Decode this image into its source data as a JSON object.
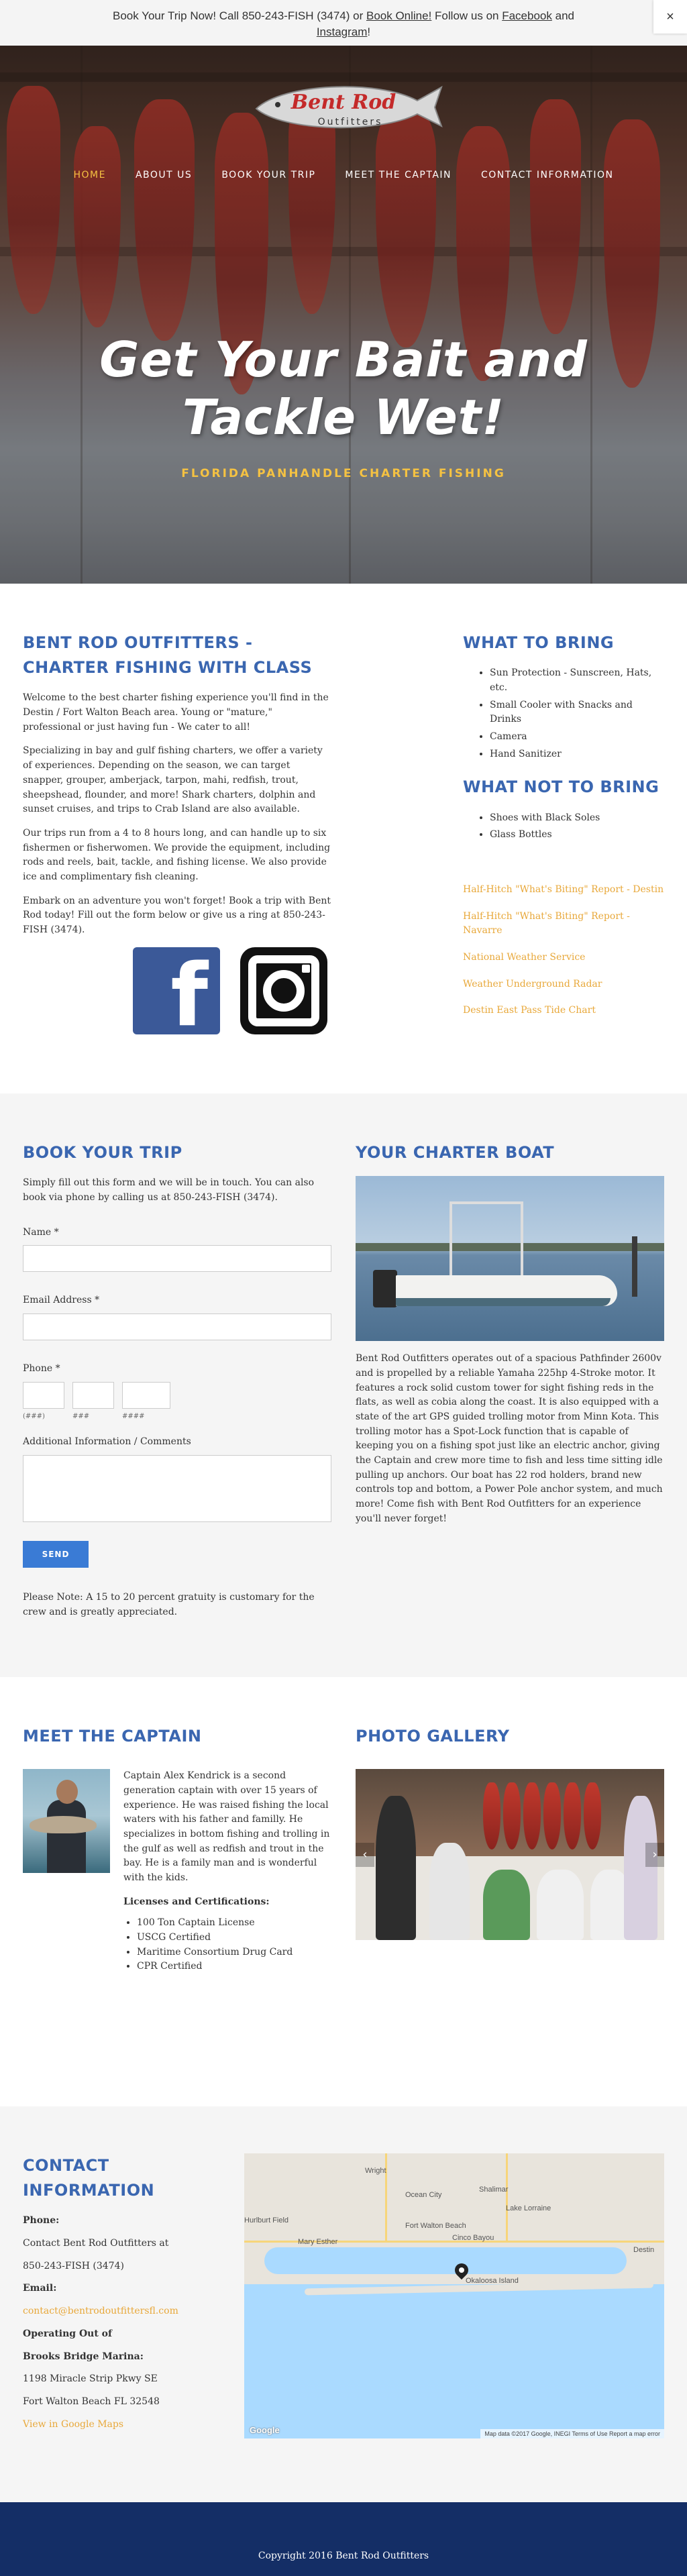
{
  "topbar": {
    "text_before": "Book Your Trip Now! Call 850-243-FISH (3474) or ",
    "book_online_link": "Book Online!",
    "text_middle": " Follow us on ",
    "facebook_link": "Facebook",
    "text_and": " and ",
    "instagram_link": "Instagram",
    "text_end": "!",
    "close_label": "×"
  },
  "logo": {
    "brand_main": "Bent Rod",
    "brand_sub": "Outfitters"
  },
  "nav": {
    "items": [
      "HOME",
      "ABOUT US",
      "BOOK YOUR TRIP",
      "MEET THE CAPTAIN",
      "CONTACT INFORMATION"
    ],
    "active_index": 0
  },
  "hero": {
    "headline_line1": "Get Your Bait and",
    "headline_line2": "Tackle Wet!",
    "subheadline": "FLORIDA PANHANDLE CHARTER FISHING"
  },
  "about": {
    "title": "BENT ROD OUTFITTERS - CHARTER FISHING WITH CLASS",
    "paragraphs": [
      "Welcome to the best charter fishing experience you'll find in the Destin / Fort Walton Beach area. Young or \"mature,\" professional or just having fun - We cater to all!",
      "Specializing in bay and gulf fishing charters, we offer a variety of experiences. Depending on the season, we can target snapper, grouper, amberjack, tarpon, mahi, redfish, trout, sheepshead, flounder, and more! Shark charters, dolphin and sunset cruises, and trips to Crab Island are also available.",
      "Our trips run from a 4 to 8 hours long, and can handle up to six fishermen or fisherwomen. We provide the equipment, including rods and reels, bait, tackle, and fishing license. We also provide ice and complimentary fish cleaning.",
      "Embark on an adventure you won't forget! Book a trip with Bent Rod today! Fill out the form below or give us a ring at 850-243-FISH (3474)."
    ],
    "facebook_glyph": "f"
  },
  "what_to_bring": {
    "title": "WHAT TO BRING",
    "items": [
      "Sun Protection - Sunscreen, Hats, etc.",
      "Small Cooler with Snacks and Drinks",
      "Camera",
      "Hand Sanitizer"
    ]
  },
  "what_not_to_bring": {
    "title": "WHAT NOT TO BRING",
    "items": [
      "Shoes with Black Soles",
      "Glass Bottles"
    ]
  },
  "links": [
    "Half-Hitch \"What's Biting\" Report - Destin",
    "Half-Hitch \"What's Biting\" Report - Navarre",
    "National Weather Service",
    "Weather Underground Radar",
    "Destin East Pass Tide Chart"
  ],
  "booking": {
    "title": "BOOK YOUR TRIP",
    "intro": "Simply fill out this form and we will be in touch. You can also book via phone by calling us at 850-243-FISH (3474).",
    "name_label": "Name *",
    "email_label": "Email Address *",
    "phone_label": "Phone *",
    "phone_hint_1": "(###)",
    "phone_hint_2": "###",
    "phone_hint_3": "####",
    "additional_label": "Additional Information / Comments",
    "send_label": "SEND",
    "note": "Please Note: A 15 to 20 percent gratuity is customary for the crew and is greatly appreciated."
  },
  "charter_boat": {
    "title": "YOUR CHARTER BOAT",
    "description": "Bent Rod Outfitters operates out of a spacious Pathfinder 2600v and is propelled by a reliable Yamaha 225hp 4-Stroke motor. It features a rock solid custom tower for sight fishing reds in the flats, as well as cobia along the coast. It is also equipped with a state of the art GPS guided trolling motor from Minn Kota. This trolling motor has a Spot-Lock function that is capable of keeping you on a fishing spot just like an electric anchor, giving the Captain and crew more time to fish and less time sitting idle pulling up anchors. Our boat has 22 rod holders, brand new controls top and bottom, a Power Pole anchor system, and much more! Come fish with Bent Rod Outfitters for an experience you'll never forget!"
  },
  "captain": {
    "title": "MEET THE CAPTAIN",
    "bio": "Captain Alex Kendrick is a second generation captain with over 15 years of experience. He was raised fishing the local waters with his father and familly. He specializes in bottom fishing and trolling in the gulf as well as redfish and trout in the bay. He is a family man and is wonderful with the kids.",
    "licenses_title": "Licenses and Certifications:",
    "licenses": [
      "100 Ton Captain License",
      "USCG Certified",
      "Maritime Consortium Drug Card",
      "CPR Certified"
    ]
  },
  "gallery": {
    "title": "PHOTO GALLERY",
    "prev": "‹",
    "next": "›"
  },
  "contact": {
    "title": "CONTACT INFORMATION",
    "phone_label": "Phone:",
    "phone_line1": "Contact Bent Rod Outfitters at",
    "phone_line2": "850-243-FISH (3474)",
    "email_label": "Email:",
    "email": "contact@bentrodoutfittersfl.com",
    "operating_label": "Operating Out of",
    "marina_label": "Brooks Bridge Marina:",
    "address_line1": "1198 Miracle Strip Pkwy SE",
    "address_line2": "Fort Walton Beach FL 32548",
    "maps_link": "View in Google Maps"
  },
  "map": {
    "labels": [
      "Wright",
      "Ocean City",
      "Shalimar",
      "Lake Lorraine",
      "Hurlburt Field",
      "Fort Walton Beach",
      "Mary Esther",
      "Cinco Bayou",
      "Okaloosa Island",
      "Destin"
    ],
    "attribution": "Map data ©2017 Google, INEGI   Terms of Use   Report a map error",
    "google_logo": "Google"
  },
  "footer": {
    "copyright": "Copyright 2016 Bent Rod Outfitters"
  },
  "colors": {
    "accent_blue": "#3a66b0",
    "link_gold": "#e8a83a",
    "nav_active": "#f5c242",
    "footer_bg": "#142e66",
    "send_button": "#3a7bd5"
  }
}
